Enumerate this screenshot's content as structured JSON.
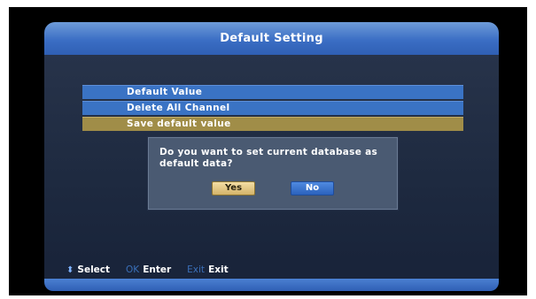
{
  "window": {
    "title": "Default Setting"
  },
  "menu": {
    "items": [
      {
        "label": "Default Value"
      },
      {
        "label": "Delete All Channel"
      },
      {
        "label": "Save default value"
      }
    ],
    "selected_index": 2
  },
  "dialog": {
    "message": "Do you want to set current database as default data?",
    "yes_label": "Yes",
    "no_label": "No",
    "focused": "Yes"
  },
  "help_bar": {
    "select_key": "⬍",
    "select_label": "Select",
    "ok_key": "OK",
    "ok_label": "Enter",
    "exit_key": "Exit",
    "exit_label": "Exit"
  },
  "colors": {
    "title_bar": "#3b6ec4",
    "menu_item": "#3a73c4",
    "menu_selected": "#a08d48",
    "dialog_bg": "#4a5a72",
    "yes_button": "#e6c98a",
    "no_button": "#3b75d1",
    "body_bg": "#1e2a40"
  }
}
